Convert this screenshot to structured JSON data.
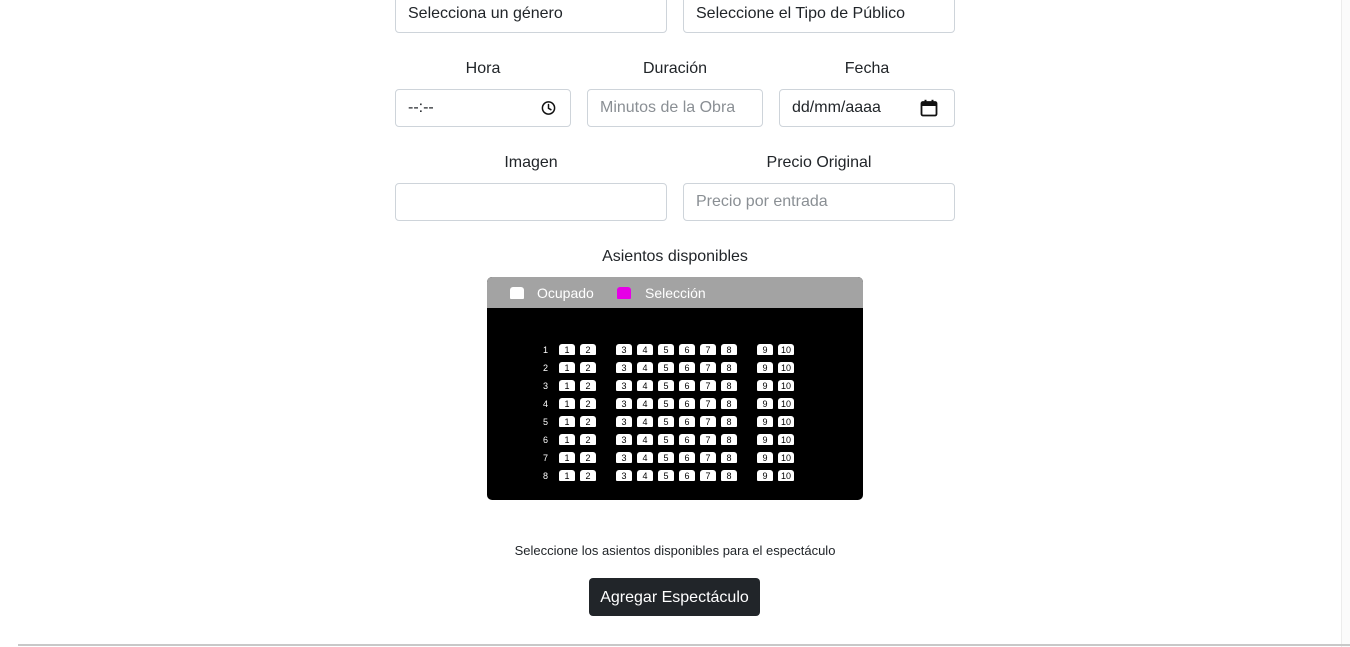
{
  "form": {
    "genre_select": "Selecciona un género",
    "audience_select": "Seleccione el Tipo de Público",
    "time": {
      "label": "Hora",
      "value": "--:--"
    },
    "duration": {
      "label": "Duración",
      "placeholder": "Minutos de la Obra"
    },
    "date": {
      "label": "Fecha",
      "value": "dd/mm/aaaa"
    },
    "image": {
      "label": "Imagen",
      "value": ""
    },
    "price": {
      "label": "Precio Original",
      "placeholder": "Precio por entrada"
    }
  },
  "seats": {
    "title": "Asientos disponibles",
    "legend": {
      "occupied": {
        "label": "Ocupado",
        "color": "#ffffff"
      },
      "selection": {
        "label": "Selección",
        "color": "#e600e6"
      }
    },
    "rows": [
      "1",
      "2",
      "3",
      "4",
      "5",
      "6",
      "7",
      "8"
    ],
    "seat_numbers": [
      "1",
      "2",
      "3",
      "4",
      "5",
      "6",
      "7",
      "8",
      "9",
      "10"
    ]
  },
  "hint": "Seleccione los asientos disponibles para el espectáculo",
  "submit_label": "Agregar Espectáculo"
}
